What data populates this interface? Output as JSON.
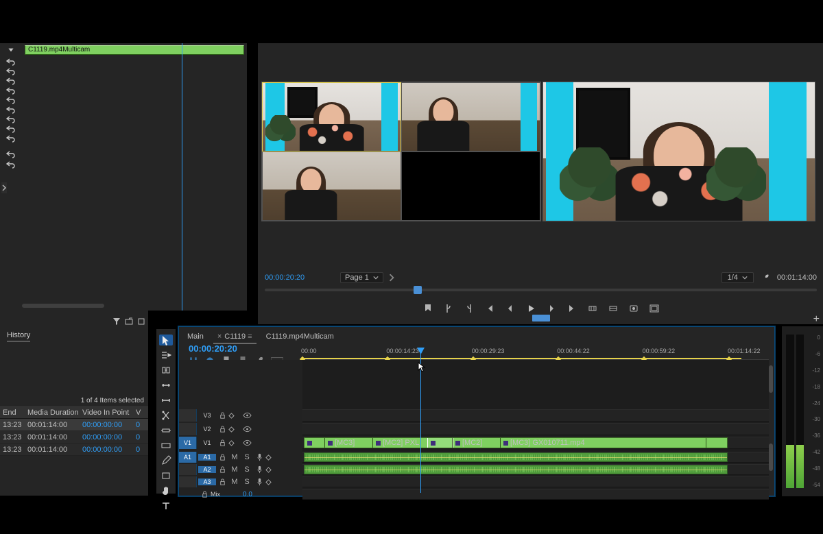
{
  "history": {
    "clip_label": "C1119.mp4Multicam",
    "items": [
      "undo",
      "undo",
      "undo",
      "undo",
      "undo",
      "undo",
      "undo",
      "undo",
      "undo"
    ]
  },
  "monitor": {
    "timecode_left": "00:00:20:20",
    "page_label": "Page 1",
    "resolution": "1/4",
    "timecode_right": "00:01:14:00",
    "transport": [
      "marker",
      "in",
      "out",
      "goto-in",
      "step-back",
      "play",
      "step-fwd",
      "goto-out",
      "lift",
      "extract",
      "export-frame",
      "safe-margins"
    ]
  },
  "project": {
    "tab": "History",
    "selection_status": "1 of 4 Items selected",
    "columns": {
      "end": "End",
      "duration": "Media Duration",
      "in": "Video In Point",
      "v": "V"
    },
    "rows": [
      {
        "end": "13:23",
        "duration": "00:01:14:00",
        "in": "00:00:00:00",
        "v": "0",
        "selected": true
      },
      {
        "end": "13:23",
        "duration": "00:01:14:00",
        "in": "00:00:00:00",
        "v": "0",
        "selected": false
      },
      {
        "end": "13:23",
        "duration": "00:01:14:00",
        "in": "00:00:00:00",
        "v": "0",
        "selected": false
      }
    ]
  },
  "tools": [
    "selection",
    "track-select",
    "ripple",
    "rolling",
    "rate-stretch",
    "razor",
    "slip",
    "slide",
    "pen",
    "rect",
    "hand",
    "type"
  ],
  "timeline": {
    "tabs": [
      {
        "label": "Main",
        "active": false
      },
      {
        "label": "C1119",
        "active": true
      },
      {
        "label": "C1119.mp4Multicam",
        "active": false
      }
    ],
    "timecode": "00:00:20:20",
    "ruler": [
      "00:00",
      "00:00:14:23",
      "00:00:29:23",
      "00:00:44:22",
      "00:00:59:22",
      "00:01:14:22"
    ],
    "video_tracks": [
      {
        "src": "",
        "label": "V3"
      },
      {
        "src": "",
        "label": "V2"
      },
      {
        "src": "V1",
        "label": "V1"
      }
    ],
    "audio_tracks": [
      {
        "src": "A1",
        "label": "A1",
        "mix": ""
      },
      {
        "src": "",
        "label": "A2",
        "mix": ""
      },
      {
        "src": "",
        "label": "A3",
        "mix": ""
      },
      {
        "src": "",
        "label": "Mix",
        "mix": "0.0"
      }
    ],
    "v1_segments": [
      "",
      "[MC3]",
      "[MC2] PXL",
      "",
      "[MC2]",
      "[MC3] GX010711.mp4"
    ],
    "mute_label": "M",
    "solo_label": "S"
  },
  "meters": {
    "scale": [
      "0",
      "-6",
      "-12",
      "-18",
      "-24",
      "-30",
      "-36",
      "-42",
      "-48",
      "-54"
    ]
  }
}
